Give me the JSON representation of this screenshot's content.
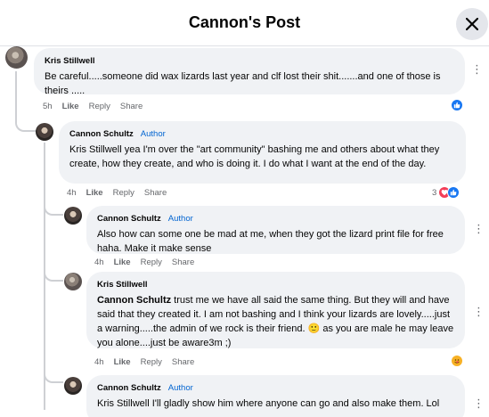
{
  "header": {
    "title": "Cannon's Post"
  },
  "colors": {
    "like": "#1877f2",
    "love": "#f33e58",
    "author": "#0064d1",
    "bubble": "#f0f2f5"
  },
  "comments": [
    {
      "author": "Kris Stillwell",
      "text": "Be careful.....someone did wax lizards last year and clf lost their shit.......and one of those is theirs .....",
      "time": "5h",
      "like": "Like",
      "reply": "Reply",
      "share": "Share",
      "reactions": [
        "like-icon"
      ]
    },
    {
      "author": "Cannon Schultz",
      "badge": "Author",
      "text": "Kris Stillwell yea I'm over the \"art community\" bashing me and others about what they create, how they create, and who is doing it. I do what I want at the end of the day.",
      "time": "4h",
      "like": "Like",
      "reply": "Reply",
      "share": "Share",
      "reaction_count": "3",
      "reactions": [
        "love-icon",
        "like-icon"
      ]
    },
    {
      "author": "Cannon Schultz",
      "badge": "Author",
      "text": "Also how can some one be mad at me, when they got the lizard print file for free haha. Make it make sense",
      "time": "4h",
      "like": "Like",
      "reply": "Reply",
      "share": "Share"
    },
    {
      "author": "Kris Stillwell",
      "mention": "Cannon Schultz",
      "text": " trust me we have all said the same thing. But they will and have said that they created it. I am not bashing and I think your lizards are lovely.....just a warning.....the admin of we rock is their friend. 🙂 as you are male he may leave you alone....just be aware3m ;)",
      "time": "4h",
      "like": "Like",
      "reply": "Reply",
      "share": "Share",
      "reactions": [
        "care-icon"
      ]
    },
    {
      "author": "Cannon Schultz",
      "badge": "Author",
      "text": "Kris Stillwell I'll gladly show him where anyone can go and also make them. Lol"
    }
  ]
}
